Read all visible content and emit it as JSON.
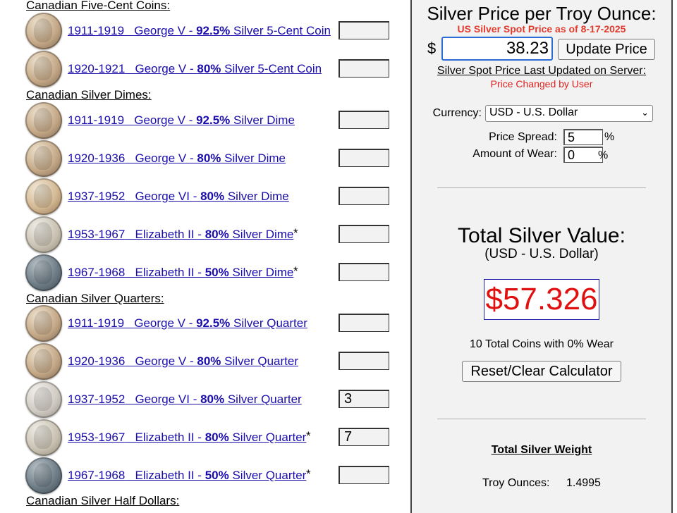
{
  "sections": [
    {
      "heading": "Canadian Five-Cent Coins:",
      "coins": [
        {
          "years": "1911-1919",
          "monarch": "George V - ",
          "purity": "92.5%",
          "type": " Silver 5-Cent Coin",
          "star": "",
          "qty": "",
          "tone": "toned"
        },
        {
          "years": "1920-1921",
          "monarch": "George V - ",
          "purity": "80%",
          "type": " Silver 5-Cent Coin",
          "star": "",
          "qty": "",
          "tone": "toned"
        }
      ]
    },
    {
      "heading": "Canadian Silver Dimes:",
      "coins": [
        {
          "years": "1911-1919",
          "monarch": "George V - ",
          "purity": "92.5%",
          "type": " Silver Dime",
          "star": "",
          "qty": "",
          "tone": "toned"
        },
        {
          "years": "1920-1936",
          "monarch": "George V - ",
          "purity": "80%",
          "type": " Silver Dime",
          "star": "",
          "qty": "",
          "tone": "toned"
        },
        {
          "years": "1937-1952",
          "monarch": "George VI - ",
          "purity": "80%",
          "type": " Silver Dime",
          "star": "",
          "qty": "",
          "tone": "gold"
        },
        {
          "years": "1953-1967",
          "monarch": "Elizabeth II - ",
          "purity": "80%",
          "type": " Silver Dime",
          "star": "*",
          "qty": "",
          "tone": "silver"
        },
        {
          "years": "1967-1968",
          "monarch": "Elizabeth II - ",
          "purity": "50%",
          "type": " Silver Dime",
          "star": "*",
          "qty": "",
          "tone": "dark"
        }
      ]
    },
    {
      "heading": "Canadian Silver Quarters:",
      "coins": [
        {
          "years": "1911-1919",
          "monarch": "George V - ",
          "purity": "92.5%",
          "type": " Silver Quarter",
          "star": "",
          "qty": "",
          "tone": "toned"
        },
        {
          "years": "1920-1936",
          "monarch": "George V - ",
          "purity": "80%",
          "type": " Silver Quarter",
          "star": "",
          "qty": "",
          "tone": "toned"
        },
        {
          "years": "1937-1952",
          "monarch": "George VI - ",
          "purity": "80%",
          "type": " Silver Quarter",
          "star": "",
          "qty": "3",
          "tone": "light"
        },
        {
          "years": "1953-1967",
          "monarch": "Elizabeth II - ",
          "purity": "80%",
          "type": " Silver Quarter",
          "star": "*",
          "qty": "7",
          "tone": "silver"
        },
        {
          "years": "1967-1968",
          "monarch": "Elizabeth II - ",
          "purity": "50%",
          "type": " Silver Quarter",
          "star": "*",
          "qty": "",
          "tone": "dark"
        }
      ]
    },
    {
      "heading": "Canadian Silver Half Dollars:",
      "coins": []
    }
  ],
  "panel": {
    "title": "Silver Price per Troy Ounce:",
    "spot_date": "US Silver Spot Price as of 8-17-2025",
    "currency_symbol": "$",
    "price": "38.23",
    "update_button": "Update Price",
    "last_updated": "Silver Spot Price Last Updated on Server:",
    "price_changed": "Price Changed by User",
    "currency_label": "Currency:",
    "currency_value": "USD - U.S. Dollar",
    "spread_label": "Price Spread:",
    "spread_value": "5",
    "wear_label": "Amount of Wear:",
    "wear_value": "0",
    "percent": "%",
    "total_label": "Total Silver Value:",
    "total_currency": "(USD - U.S. Dollar)",
    "total_value": "$57.326",
    "coins_summary": "10 Total Coins with 0% Wear",
    "reset_button": "Reset/Clear Calculator",
    "weight_title": "Total Silver Weight",
    "troy_label": "Troy Ounces:",
    "troy_value": "1.4995"
  },
  "colors": {
    "link": "#1a0dab",
    "total_value": "#e01010",
    "spot_date": "#e23b2e",
    "input_focus": "#2b6cd4"
  }
}
